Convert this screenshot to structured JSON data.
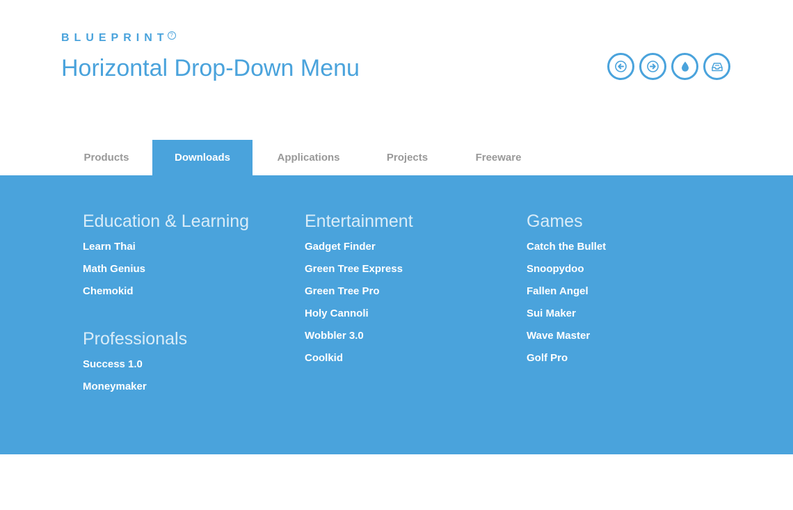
{
  "header": {
    "brand": "BLUEPRINT",
    "brand_help_glyph": "?",
    "title": "Horizontal Drop-Down Menu",
    "icons": [
      "arrow-left-icon",
      "arrow-right-icon",
      "drop-icon",
      "inbox-icon"
    ],
    "accent_color": "#4aa3dc"
  },
  "nav": {
    "tabs": [
      {
        "label": "Products"
      },
      {
        "label": "Downloads"
      },
      {
        "label": "Applications"
      },
      {
        "label": "Projects"
      },
      {
        "label": "Freeware"
      }
    ],
    "active_tab": "Downloads"
  },
  "dropdown": {
    "columns": [
      {
        "groups": [
          {
            "title": "Education & Learning",
            "items": [
              "Learn Thai",
              "Math Genius",
              "Chemokid"
            ]
          },
          {
            "title": "Professionals",
            "items": [
              "Success 1.0",
              "Moneymaker"
            ]
          }
        ]
      },
      {
        "groups": [
          {
            "title": "Entertainment",
            "items": [
              "Gadget Finder",
              "Green Tree Express",
              "Green Tree Pro",
              "Holy Cannoli",
              "Wobbler 3.0",
              "Coolkid"
            ]
          }
        ]
      },
      {
        "groups": [
          {
            "title": "Games",
            "items": [
              "Catch the Bullet",
              "Snoopydoo",
              "Fallen Angel",
              "Sui Maker",
              "Wave Master",
              "Golf Pro"
            ]
          }
        ]
      }
    ]
  }
}
